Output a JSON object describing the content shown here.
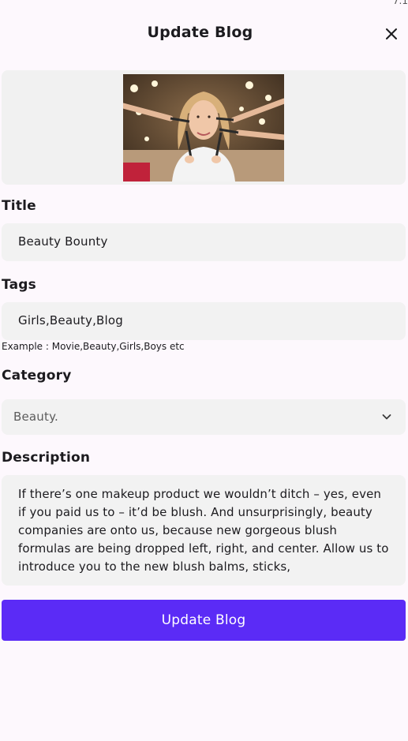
{
  "status_fragment": "7.1",
  "header": {
    "title": "Update Blog",
    "close_icon": "close-icon"
  },
  "image": {
    "icon": "photo-woman-makeup"
  },
  "form": {
    "title": {
      "label": "Title",
      "value": "Beauty Bounty"
    },
    "tags": {
      "label": "Tags",
      "value": "Girls,Beauty,Blog",
      "hint": "Example : Movie,Beauty,Girls,Boys etc"
    },
    "category": {
      "label": "Category",
      "selected": "Beauty.",
      "icon": "chevron-down-icon"
    },
    "description": {
      "label": "Description",
      "value": "If there’s one makeup product we wouldn’t ditch – yes, even if you paid us to – it’d be blush. And unsurprisingly, beauty companies are onto us, because new gorgeous blush formulas are being dropped left, right, and center. Allow us to introduce you to the new blush balms, sticks,"
    }
  },
  "submit": {
    "label": "Update Blog"
  },
  "colors": {
    "background": "#fdf8fd",
    "field_bg": "#f2f2f2",
    "primary": "#5b2bf6"
  }
}
